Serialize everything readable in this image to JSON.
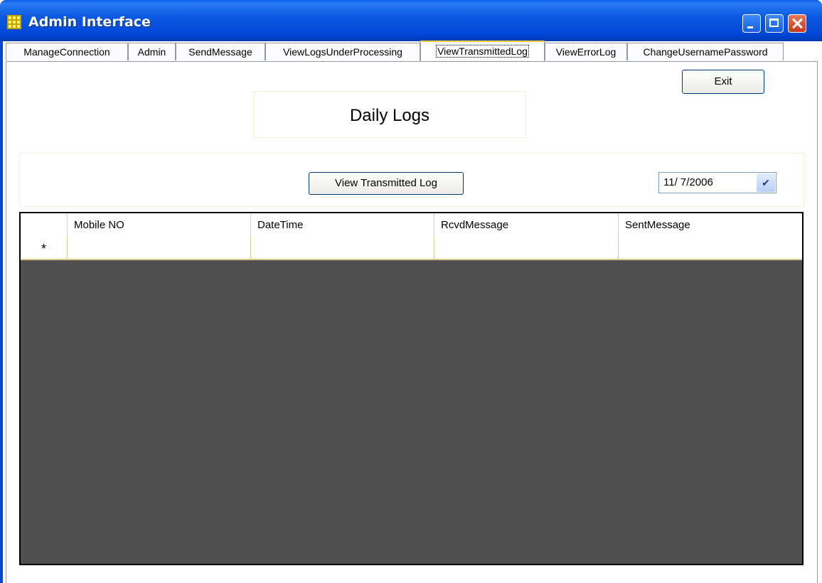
{
  "window": {
    "title": "Admin Interface",
    "icon": "app-grid-icon",
    "controls": [
      "minimize-icon",
      "maximize-icon",
      "close-icon"
    ]
  },
  "tabs": [
    {
      "label": "ManageConnection"
    },
    {
      "label": "Admin"
    },
    {
      "label": "SendMessage"
    },
    {
      "label": "ViewLogsUnderProcessing"
    },
    {
      "label": "ViewTransmittedLog",
      "active": true
    },
    {
      "label": "ViewErrorLog"
    },
    {
      "label": "ChangeUsernamePassword"
    }
  ],
  "panel": {
    "exit_label": "Exit",
    "heading": "Daily Logs",
    "view_button_label": "View Transmitted Log",
    "date_value": "11/  7/2006",
    "date_dropdown_icon": "chevron-down-icon"
  },
  "grid": {
    "columns": [
      "Mobile NO",
      "DateTime",
      "RcvdMessage",
      "SentMessage"
    ],
    "new_row_marker": "*",
    "rows": []
  },
  "colors": {
    "titlebar": "#0046d6",
    "grid_background": "#505050",
    "active_tab_accent": "#ffc83c"
  }
}
